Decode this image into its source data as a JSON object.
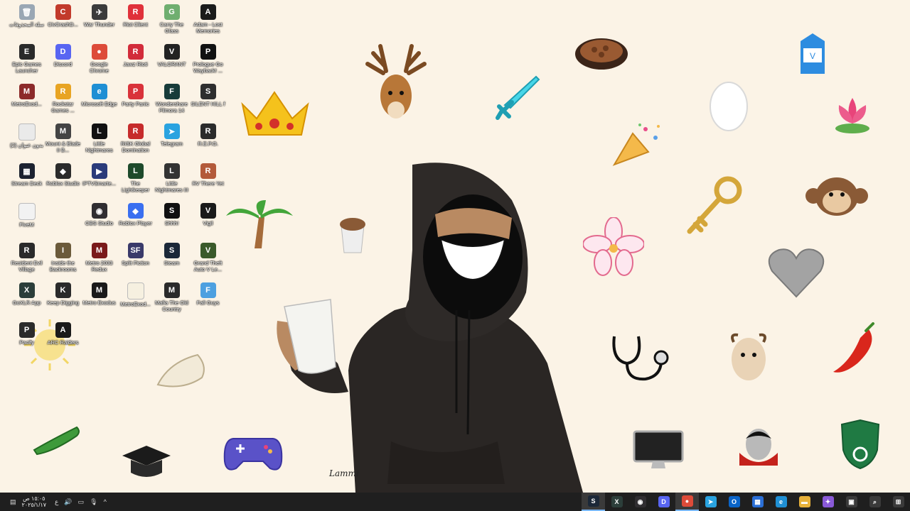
{
  "desktop": {
    "icons": [
      {
        "label": "سلة المحذوفات",
        "color": "#9aa7b4",
        "glyph": "🗑",
        "icon": "recycle-bin-icon"
      },
      {
        "label": "CivCrashD...",
        "color": "#c23a2b",
        "glyph": "C",
        "icon": "winrar-icon"
      },
      {
        "label": "War Thunder",
        "color": "#3b3b3b",
        "glyph": "✈",
        "icon": "war-thunder-icon"
      },
      {
        "label": "Riot Client",
        "color": "#e0313a",
        "glyph": "R",
        "icon": "riot-client-icon"
      },
      {
        "label": "Carry The Glass",
        "color": "#6fae6f",
        "glyph": "G",
        "icon": "carry-the-glass-icon"
      },
      {
        "label": "Adam - Lost Memories",
        "color": "#1b1b1b",
        "glyph": "A",
        "icon": "adam-game-icon"
      },
      {
        "label": "Epic Games Launcher",
        "color": "#2a2a2a",
        "glyph": "E",
        "icon": "epic-games-icon"
      },
      {
        "label": "Discord",
        "color": "#5865f2",
        "glyph": "D",
        "icon": "discord-icon"
      },
      {
        "label": "Google Chrome",
        "color": "#dd4b39",
        "glyph": "●",
        "icon": "chrome-icon"
      },
      {
        "label": "Jawz Rioti",
        "color": "#d22b3a",
        "glyph": "R",
        "icon": "riot-icon"
      },
      {
        "label": "VALORANT",
        "color": "#222",
        "glyph": "V",
        "icon": "valorant-icon"
      },
      {
        "label": "Prologue Go Wayback! ...",
        "color": "#111",
        "glyph": "P",
        "icon": "prologue-icon"
      },
      {
        "label": "MetroExod...",
        "color": "#8c2a2a",
        "glyph": "M",
        "icon": "winrar-icon"
      },
      {
        "label": "Rockstar Games ...",
        "color": "#e8a423",
        "glyph": "R",
        "icon": "rockstar-icon"
      },
      {
        "label": "Microsoft Edge",
        "color": "#1f8fd4",
        "glyph": "e",
        "icon": "edge-icon"
      },
      {
        "label": "Party Panic",
        "color": "#d9323a",
        "glyph": "P",
        "icon": "party-panic-icon"
      },
      {
        "label": "Wondershare Filmora 14",
        "color": "#173b3a",
        "glyph": "F",
        "icon": "filmora-icon"
      },
      {
        "label": "SILENT HILL f",
        "color": "#2e2e2e",
        "glyph": "S",
        "icon": "silent-hill-icon"
      },
      {
        "label": "بدون عنوان (2)",
        "color": "#eaeaea",
        "glyph": "",
        "icon": "document-icon"
      },
      {
        "label": "Mount & Blade II B...",
        "color": "#444",
        "glyph": "M",
        "icon": "mount-blade-icon"
      },
      {
        "label": "Little Nightmares",
        "color": "#111",
        "glyph": "L",
        "icon": "little-nightmares-icon"
      },
      {
        "label": "RISK Global Domination",
        "color": "#c62b2b",
        "glyph": "R",
        "icon": "risk-icon"
      },
      {
        "label": "Telegram",
        "color": "#2aa3e0",
        "glyph": "➤",
        "icon": "telegram-icon"
      },
      {
        "label": "R.E.P.O.",
        "color": "#2b2b2b",
        "glyph": "R",
        "icon": "repo-icon"
      },
      {
        "label": "Stream Deck",
        "color": "#1c2230",
        "glyph": "▦",
        "icon": "stream-deck-icon"
      },
      {
        "label": "Roblox Studio",
        "color": "#2b2b2b",
        "glyph": "◆",
        "icon": "roblox-studio-icon"
      },
      {
        "label": "IPTVSmarte...",
        "color": "#2b3b7a",
        "glyph": "▶",
        "icon": "iptv-icon"
      },
      {
        "label": "The Lightkeeper",
        "color": "#1e4a2b",
        "glyph": "L",
        "icon": "lightkeeper-icon"
      },
      {
        "label": "Little Nightmares III",
        "color": "#333",
        "glyph": "L",
        "icon": "little-nightmares-3-icon"
      },
      {
        "label": "RV There Yet",
        "color": "#b35a3a",
        "glyph": "R",
        "icon": "rv-there-yet-icon"
      },
      {
        "label": "FiveM",
        "color": "#f2f2f2",
        "glyph": "",
        "icon": "fivem-icon"
      },
      {
        "label": "",
        "color": "transparent",
        "glyph": "",
        "icon": "empty-slot"
      },
      {
        "label": "OBS Studio",
        "color": "#302e31",
        "glyph": "◉",
        "icon": "obs-icon"
      },
      {
        "label": "Roblox Player",
        "color": "#3a6ff0",
        "glyph": "◆",
        "icon": "roblox-player-icon"
      },
      {
        "label": "Shhh!",
        "color": "#101010",
        "glyph": "S",
        "icon": "shhh-icon"
      },
      {
        "label": "Vigil",
        "color": "#1a1a1a",
        "glyph": "V",
        "icon": "vigil-icon"
      },
      {
        "label": "Resident Evil Village",
        "color": "#2a2a2a",
        "glyph": "R",
        "icon": "resident-evil-icon"
      },
      {
        "label": "Inside the Backrooms",
        "color": "#6b5a3a",
        "glyph": "I",
        "icon": "backrooms-icon"
      },
      {
        "label": "Metro 2033 Redux",
        "color": "#7a1a1a",
        "glyph": "M",
        "icon": "metro-2033-icon"
      },
      {
        "label": "Split Fiction",
        "color": "#3a3a6a",
        "glyph": "SF",
        "icon": "split-fiction-icon"
      },
      {
        "label": "Steam",
        "color": "#1b2838",
        "glyph": "S",
        "icon": "steam-icon"
      },
      {
        "label": "Grand Theft Auto V Le...",
        "color": "#3a5a2a",
        "glyph": "V",
        "icon": "gta-icon"
      },
      {
        "label": "GoXLR App",
        "color": "#2c3e3a",
        "glyph": "X",
        "icon": "goxlr-icon"
      },
      {
        "label": "Keep Digging",
        "color": "#2a2a2a",
        "glyph": "K",
        "icon": "keep-digging-icon"
      },
      {
        "label": "Metro Exodus",
        "color": "#1a1a1a",
        "glyph": "M",
        "icon": "metro-exodus-icon"
      },
      {
        "label": "MetroExod...",
        "color": "#f6f0e0",
        "glyph": "",
        "icon": "zip-icon"
      },
      {
        "label": "Mafia The Old Country",
        "color": "#2a2a2a",
        "glyph": "M",
        "icon": "mafia-icon"
      },
      {
        "label": "Fall Guys",
        "color": "#4da0e0",
        "glyph": "F",
        "icon": "fall-guys-icon"
      },
      {
        "label": "Pacify",
        "color": "#2b2b2b",
        "glyph": "P",
        "icon": "pacify-icon"
      },
      {
        "label": "ARC Raiders",
        "color": "#1a1a1a",
        "glyph": "A",
        "icon": "arc-raiders-icon"
      }
    ]
  },
  "artwork": {
    "signature": "Lammi"
  },
  "taskbar": {
    "clock_time": "١٥:٠٥ ص",
    "clock_date": "٢٠٢٥/١/١٧",
    "lang": "ع",
    "apps": [
      {
        "name": "steam",
        "glyph": "S",
        "color": "#1b2838",
        "active": true,
        "icon": "steam-taskbar-icon"
      },
      {
        "name": "goxlr",
        "glyph": "X",
        "color": "#2c3e3a",
        "active": false,
        "icon": "goxlr-taskbar-icon"
      },
      {
        "name": "obs",
        "glyph": "◉",
        "color": "#302e31",
        "active": false,
        "icon": "obs-taskbar-icon"
      },
      {
        "name": "discord",
        "glyph": "D",
        "color": "#5865f2",
        "active": false,
        "icon": "discord-taskbar-icon"
      },
      {
        "name": "chrome",
        "glyph": "●",
        "color": "#dd4b39",
        "active": true,
        "icon": "chrome-taskbar-icon"
      },
      {
        "name": "telegram",
        "glyph": "➤",
        "color": "#2aa3e0",
        "active": false,
        "icon": "telegram-taskbar-icon"
      },
      {
        "name": "outlook",
        "glyph": "O",
        "color": "#0a64c8",
        "active": false,
        "icon": "outlook-taskbar-icon"
      },
      {
        "name": "store",
        "glyph": "▦",
        "color": "#2b6fd6",
        "active": false,
        "icon": "store-taskbar-icon"
      },
      {
        "name": "edge",
        "glyph": "e",
        "color": "#1f8fd4",
        "active": false,
        "icon": "edge-taskbar-icon"
      },
      {
        "name": "explorer",
        "glyph": "▬",
        "color": "#e8b23a",
        "active": false,
        "icon": "folder-taskbar-icon"
      },
      {
        "name": "copilot",
        "glyph": "✦",
        "color": "#8a5ad8",
        "active": false,
        "icon": "copilot-taskbar-icon"
      },
      {
        "name": "taskview",
        "glyph": "▣",
        "color": "#3a3a3a",
        "active": false,
        "icon": "task-view-icon"
      },
      {
        "name": "search",
        "glyph": "⌕",
        "color": "#3a3a3a",
        "active": false,
        "icon": "search-icon"
      },
      {
        "name": "start",
        "glyph": "⊞",
        "color": "#3a3a3a",
        "active": false,
        "icon": "windows-start-icon"
      }
    ]
  }
}
